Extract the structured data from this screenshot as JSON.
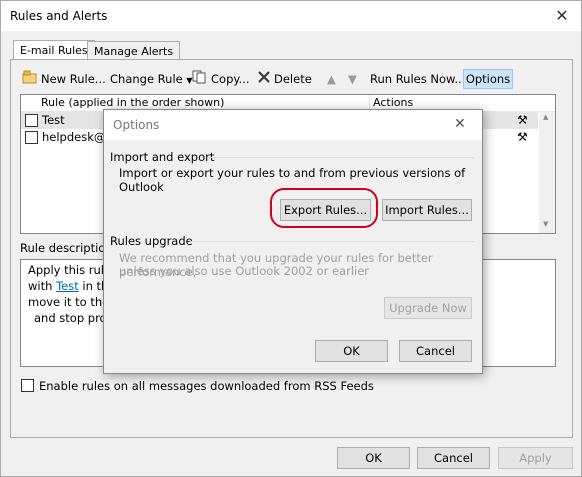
{
  "window": {
    "title": "Rules and Alerts",
    "close_glyph": "✕"
  },
  "tabs": [
    {
      "label": "E-mail Rules"
    },
    {
      "label": "Manage Alerts"
    }
  ],
  "toolbar": {
    "new_rule": "New Rule...",
    "change_rule": "Change Rule",
    "copy": "Copy...",
    "delete": "Delete",
    "run_rules_now": "Run Rules Now...",
    "options": "Options"
  },
  "rules_list": {
    "headers": {
      "rule": "Rule (applied in the order shown)",
      "actions": "Actions"
    },
    "rows": [
      {
        "name": "Test"
      },
      {
        "name": "helpdesk@er"
      }
    ]
  },
  "description": {
    "label": "Rule description",
    "lines": [
      "Apply this rule",
      "with",
      "Test",
      "in th",
      "move it to the",
      "and stop proc"
    ]
  },
  "rss_checkbox_label": "Enable rules on all messages downloaded from RSS Feeds",
  "footer": {
    "ok": "OK",
    "cancel": "Cancel",
    "apply": "Apply"
  },
  "options_dialog": {
    "title": "Options",
    "close_glyph": "✕",
    "import_export": {
      "heading": "Import and export",
      "text": "Import or export your rules to and from previous versions of Outlook",
      "export_button": "Export Rules...",
      "import_button": "Import Rules..."
    },
    "rules_upgrade": {
      "heading": "Rules upgrade",
      "text_line1": "We recommend that you upgrade your rules for better performance,",
      "text_line2": "unless you also use Outlook 2002 or earlier",
      "upgrade_button": "Upgrade Now"
    },
    "ok": "OK",
    "cancel": "Cancel"
  },
  "colors": {
    "highlight": "#d0021b",
    "selected_button": "#cce4f7",
    "link": "#0066cc"
  }
}
